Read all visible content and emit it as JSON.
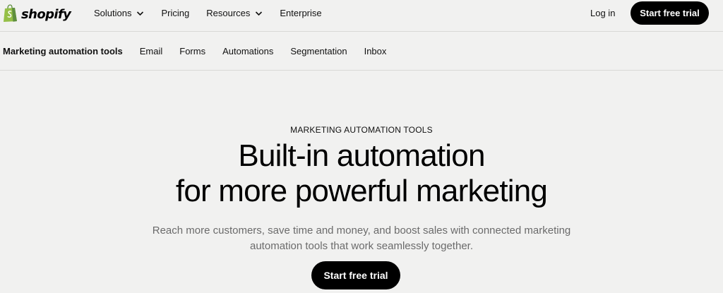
{
  "brand": {
    "name": "shopify",
    "logo_icon": "shopping-bag-icon",
    "logo_color": "#95bf47"
  },
  "topnav": {
    "menu": [
      {
        "label": "Solutions",
        "has_dropdown": true
      },
      {
        "label": "Pricing",
        "has_dropdown": false
      },
      {
        "label": "Resources",
        "has_dropdown": true
      },
      {
        "label": "Enterprise",
        "has_dropdown": false
      }
    ],
    "login_label": "Log in",
    "cta_label": "Start free trial"
  },
  "subnav": {
    "title": "Marketing automation tools",
    "links": [
      "Email",
      "Forms",
      "Automations",
      "Segmentation",
      "Inbox"
    ]
  },
  "hero": {
    "eyebrow": "MARKETING AUTOMATION TOOLS",
    "headline_line1": "Built-in automation",
    "headline_line2": "for more powerful marketing",
    "subtext": "Reach more customers, save time and money, and boost sales with connected marketing automation tools that work seamlessly together.",
    "cta_label": "Start free trial"
  },
  "colors": {
    "background": "#f1f1f0",
    "button_bg": "#000000",
    "button_text": "#ffffff",
    "muted_text": "#6b6b6b"
  }
}
